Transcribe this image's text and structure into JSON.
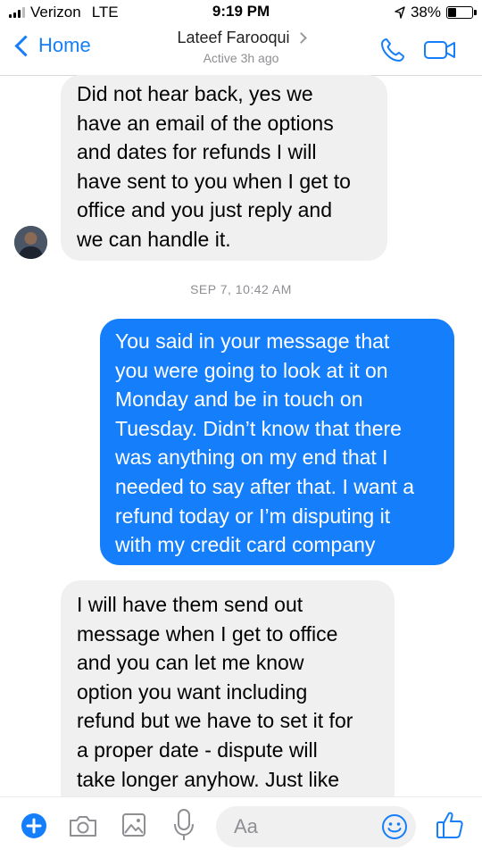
{
  "status_bar": {
    "carrier": "Verizon",
    "network": "LTE",
    "time": "9:19 PM",
    "battery_percent": "38%",
    "battery_level": 0.38
  },
  "header": {
    "back_label": "Home",
    "contact_name": "Lateef Farooqui",
    "contact_status": "Active 3h ago",
    "call_icon": "phone-icon",
    "video_icon": "video-camera-icon"
  },
  "messages": [
    {
      "direction": "incoming",
      "lines": [
        "Did not hear back, yes we",
        "have an email of the options",
        "and dates for refunds I will",
        "have sent to you when I get to",
        "office and you just reply and",
        "we can handle it."
      ]
    },
    {
      "direction": "outgoing",
      "lines": [
        "You said in your message that",
        "you were going to look at it on",
        "Monday and be in touch on",
        "Tuesday. Didn’t know that there",
        "was anything on my end that I",
        "needed to say after that. I want a",
        "refund today or I’m disputing it",
        "with my credit card company"
      ]
    },
    {
      "direction": "incoming",
      "lines": [
        "I will have them send out",
        "message when I get to office",
        "and you can let me know",
        "option you want including",
        "refund but we have to set it for",
        "a proper date - dispute will",
        "take longer anyhow. Just like"
      ]
    }
  ],
  "timestamp": "SEP 7, 10:42 AM",
  "composer": {
    "placeholder": "Aa",
    "icons": [
      "plus-icon",
      "camera-icon",
      "image-icon",
      "microphone-icon",
      "emoji-icon",
      "thumbs-up-icon"
    ]
  },
  "colors": {
    "accent": "#147efb",
    "incoming_bubble": "#f1f0f0",
    "outgoing_bubble": "#147efb"
  }
}
